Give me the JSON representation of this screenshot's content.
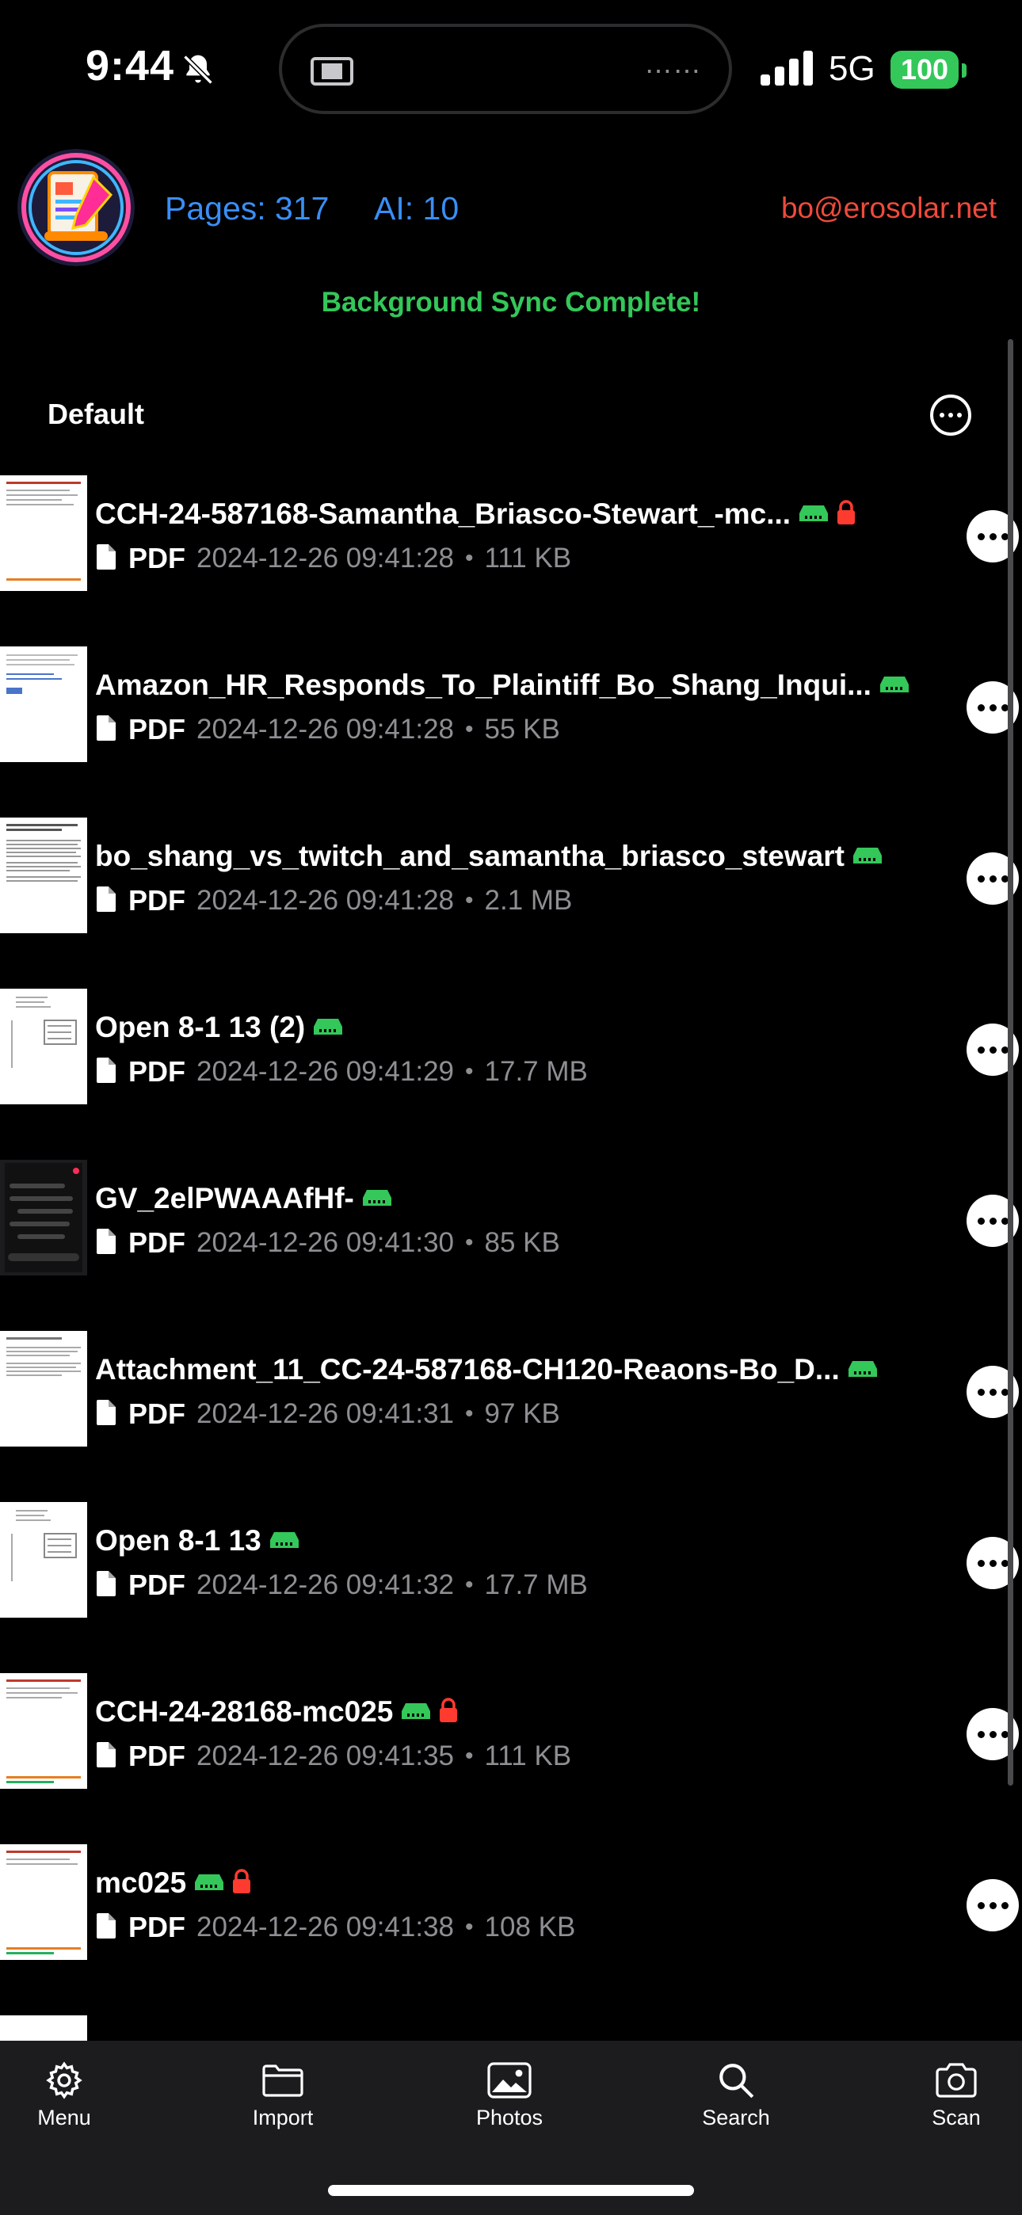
{
  "status_bar": {
    "time": "9:44",
    "network": "5G",
    "battery": "100"
  },
  "header": {
    "pages_label": "Pages: 317",
    "ai_label": "AI: 10",
    "email": "bo@erosolar.net",
    "sync_message": "Background Sync Complete!"
  },
  "folder": {
    "name": "Default"
  },
  "files": [
    {
      "title": "CCH-24-587168-Samantha_Briasco-Stewart_-mc...",
      "type": "PDF",
      "date": "2024-12-26 09:41:28",
      "sep": "•",
      "size": "111 KB",
      "locked": true
    },
    {
      "title": "Amazon_HR_Responds_To_Plaintiff_Bo_Shang_Inqui...",
      "type": "PDF",
      "date": "2024-12-26 09:41:28",
      "sep": "•",
      "size": "55 KB",
      "locked": false
    },
    {
      "title": "bo_shang_vs_twitch_and_samantha_briasco_stewart",
      "type": "PDF",
      "date": "2024-12-26 09:41:28",
      "sep": "•",
      "size": "2.1 MB",
      "locked": false
    },
    {
      "title": "Open 8-1 13 (2)",
      "type": "PDF",
      "date": "2024-12-26 09:41:29",
      "sep": "•",
      "size": "17.7 MB",
      "locked": false
    },
    {
      "title": "GV_2elPWAAAfHf-",
      "type": "PDF",
      "date": "2024-12-26 09:41:30",
      "sep": "•",
      "size": "85 KB",
      "locked": false
    },
    {
      "title": "Attachment_11_CC-24-587168-CH120-Reaons-Bo_D...",
      "type": "PDF",
      "date": "2024-12-26 09:41:31",
      "sep": "•",
      "size": "97 KB",
      "locked": false
    },
    {
      "title": "Open 8-1 13",
      "type": "PDF",
      "date": "2024-12-26 09:41:32",
      "sep": "•",
      "size": "17.7 MB",
      "locked": false
    },
    {
      "title": "CCH-24-28168-mc025",
      "type": "PDF",
      "date": "2024-12-26 09:41:35",
      "sep": "•",
      "size": "111 KB",
      "locked": true
    },
    {
      "title": "mc025",
      "type": "PDF",
      "date": "2024-12-26 09:41:38",
      "sep": "•",
      "size": "108 KB",
      "locked": true
    }
  ],
  "tabs": [
    {
      "label": "Menu",
      "icon": "gear-icon"
    },
    {
      "label": "Import",
      "icon": "folder-icon"
    },
    {
      "label": "Photos",
      "icon": "photo-icon"
    },
    {
      "label": "Search",
      "icon": "search-icon"
    },
    {
      "label": "Scan",
      "icon": "camera-icon"
    }
  ],
  "colors": {
    "accent_blue": "#3a8ef6",
    "email_red": "#ef4a3c",
    "sync_green": "#34c759",
    "lock_red": "#ff3b30"
  }
}
